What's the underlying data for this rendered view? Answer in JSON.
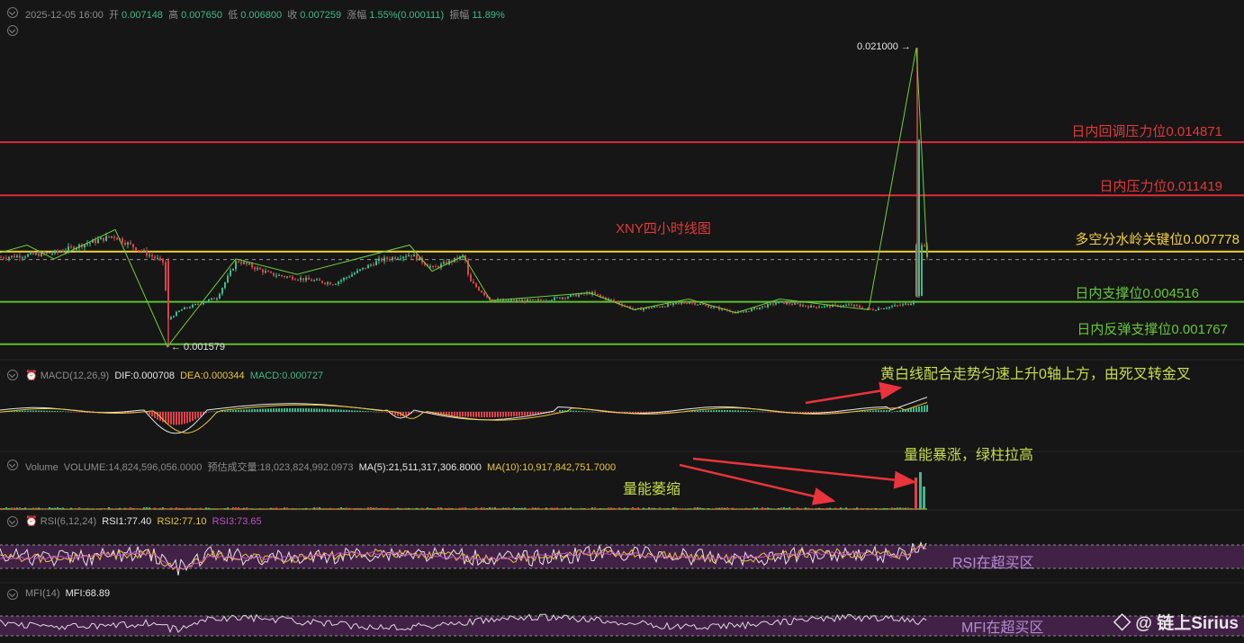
{
  "header": {
    "datetime": "2025-12-05 16:00",
    "open_label": "开",
    "open": "0.007148",
    "high_label": "高",
    "high": "0.007650",
    "low_label": "低",
    "low": "0.006800",
    "close_label": "收",
    "close": "0.007259",
    "change_label": "涨幅",
    "change": "1.55%(0.000111)",
    "amplitude_label": "振幅",
    "amplitude": "11.89%"
  },
  "main": {
    "title": "XNY四小时线图",
    "high_marker": "0.021000 →",
    "low_marker": "← 0.001579",
    "levels": [
      {
        "label": "日内回调压力位0.014871",
        "value": 0.014871,
        "color": "#e0283a"
      },
      {
        "label": "日内压力位0.011419",
        "value": 0.011419,
        "color": "#e0283a"
      },
      {
        "label": "多空分水岭关键位0.007778",
        "value": 0.007778,
        "color": "#f0d23a"
      },
      {
        "label": "日内支撑位0.004516",
        "value": 0.004516,
        "color": "#5cbe30"
      },
      {
        "label": "日内反弹支撑位0.001767",
        "value": 0.001767,
        "color": "#5cbe30"
      }
    ]
  },
  "macd": {
    "title": "MACD(12,26,9)",
    "dif": "DIF:0.000708",
    "dea": "DEA:0.000344",
    "macd": "MACD:0.000727",
    "annotation": "黄白线配合走势匀速上升0轴上方，由死叉转金叉"
  },
  "volume": {
    "title": "Volume",
    "volume": "VOLUME:14,824,596,056.0000",
    "estimate": "预估成交量:18,023,824,992.0973",
    "ma5": "MA(5):21,511,317,306.8000",
    "ma10": "MA(10):10,917,842,751.7000",
    "annotation_surge": "量能暴涨，绿柱拉高",
    "annotation_shrink": "量能萎缩"
  },
  "rsi": {
    "title": "RSI(6,12,24)",
    "rsi1": "RSI1:77.40",
    "rsi2": "RSI2:77.10",
    "rsi3": "RSI3:73.65",
    "annotation": "RSI在超买区"
  },
  "mfi": {
    "title": "MFI(14)",
    "mfi": "MFI:68.89",
    "annotation": "MFI在超买区"
  },
  "watermark": "◇ @ 链上Sirius",
  "colors": {
    "up": "#3fb98a",
    "down": "#e0414a",
    "zigzag": "#6fcf3a",
    "dif": "#e6e6e6",
    "dea": "#e8c53a",
    "rsi3": "#c04fc9",
    "overbought": "#4a2350"
  },
  "chart_data": [
    {
      "type": "candlestick",
      "title": "XNY四小时线图",
      "ylim": [
        0.0014,
        0.0215
      ],
      "high_point": 0.021,
      "low_point": 0.001579,
      "horizontal_levels": [
        0.014871,
        0.011419,
        0.007778,
        0.004516,
        0.001767
      ],
      "close_path": [
        [
          0,
          0.0074
        ],
        [
          60,
          0.0077
        ],
        [
          125,
          0.0088
        ],
        [
          150,
          0.008
        ],
        [
          180,
          0.0071
        ],
        [
          186,
          0.0034
        ],
        [
          200,
          0.004
        ],
        [
          240,
          0.0048
        ],
        [
          262,
          0.0072
        ],
        [
          300,
          0.0063
        ],
        [
          370,
          0.0057
        ],
        [
          420,
          0.0072
        ],
        [
          455,
          0.0076
        ],
        [
          480,
          0.0067
        ],
        [
          515,
          0.0075
        ],
        [
          520,
          0.0059
        ],
        [
          545,
          0.0046
        ],
        [
          600,
          0.0046
        ],
        [
          655,
          0.0051
        ],
        [
          705,
          0.004
        ],
        [
          765,
          0.0045
        ],
        [
          820,
          0.0038
        ],
        [
          865,
          0.0045
        ],
        [
          900,
          0.0042
        ],
        [
          945,
          0.0043
        ],
        [
          965,
          0.004
        ],
        [
          1010,
          0.0044
        ],
        [
          1018,
          0.0049
        ],
        [
          1022,
          0.015
        ],
        [
          1026,
          0.0082
        ],
        [
          1030,
          0.0073
        ]
      ],
      "zigzag": [
        [
          0,
          0.0077
        ],
        [
          30,
          0.0082
        ],
        [
          60,
          0.0073
        ],
        [
          128,
          0.0092
        ],
        [
          186,
          0.0016
        ],
        [
          262,
          0.0073
        ],
        [
          330,
          0.0063
        ],
        [
          455,
          0.0082
        ],
        [
          480,
          0.0065
        ],
        [
          515,
          0.0075
        ],
        [
          545,
          0.0046
        ],
        [
          655,
          0.0051
        ],
        [
          705,
          0.004
        ],
        [
          765,
          0.0047
        ],
        [
          818,
          0.0038
        ],
        [
          866,
          0.0047
        ],
        [
          965,
          0.004
        ],
        [
          1018,
          0.021
        ],
        [
          1030,
          0.0074
        ]
      ]
    },
    {
      "type": "macd",
      "dif": 0.000708,
      "dea": 0.000344,
      "macd": 0.000727
    },
    {
      "type": "bar",
      "series_name": "Volume",
      "volume": 14824596056.0,
      "ma5": 21511317306.8,
      "ma10": 10917842751.7
    },
    {
      "type": "line",
      "series": [
        {
          "name": "RSI1",
          "last": 77.4
        },
        {
          "name": "RSI2",
          "last": 77.1
        },
        {
          "name": "RSI3",
          "last": 73.65
        }
      ]
    },
    {
      "type": "line",
      "series": [
        {
          "name": "MFI",
          "last": 68.89
        }
      ]
    }
  ]
}
